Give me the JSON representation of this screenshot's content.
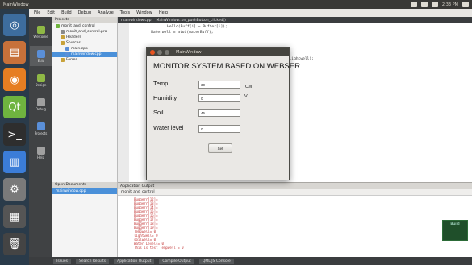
{
  "top_panel": {
    "title": "MainWindow",
    "time": "2:33 PM"
  },
  "launcher": {
    "items": [
      {
        "name": "dash-icon",
        "glyph": "◎",
        "color": "#3d6d9e"
      },
      {
        "name": "files-icon",
        "glyph": "▤",
        "color": "#c7713a"
      },
      {
        "name": "firefox-icon",
        "glyph": "◉",
        "color": "#e67e22"
      },
      {
        "name": "qtcreator-icon",
        "glyph": "Qt",
        "color": "#6fb43f"
      },
      {
        "name": "terminal-icon",
        "glyph": ">_",
        "color": "#2e2e2e"
      },
      {
        "name": "writer-icon",
        "glyph": "▥",
        "color": "#3b7dd8"
      },
      {
        "name": "settings-icon",
        "glyph": "⚙",
        "color": "#7a7a7a"
      },
      {
        "name": "workspace-icon",
        "glyph": "▦",
        "color": "#555"
      },
      {
        "name": "trash-icon",
        "glyph": "🗑",
        "color": "#444"
      }
    ]
  },
  "qtc": {
    "menu": [
      "File",
      "Edit",
      "Build",
      "Debug",
      "Analyze",
      "Tools",
      "Window",
      "Help"
    ],
    "modes": [
      "Welcome",
      "Edit",
      "Design",
      "Debug",
      "Projects",
      "Help"
    ],
    "projects_header": "Projects",
    "tree": [
      {
        "label": "monit_and_control",
        "indent": 4,
        "sel": false
      },
      {
        "label": "monit_and_control.pro",
        "indent": 10,
        "sel": false
      },
      {
        "label": "Headers",
        "indent": 10,
        "sel": false
      },
      {
        "label": "Sources",
        "indent": 10,
        "sel": false
      },
      {
        "label": "main.cpp",
        "indent": 16,
        "sel": false
      },
      {
        "label": "mainwindow.cpp",
        "indent": 16,
        "sel": true
      },
      {
        "label": "Forms",
        "indent": 10,
        "sel": false
      }
    ],
    "open_docs_header": "Open Documents",
    "open_docs_items": [
      "mainwindow.cpp"
    ],
    "editor_tabs": [
      "mainwindow.cpp",
      "MainWindow::on_pushButton_clicked()"
    ],
    "code_lines": [
      "    Hello(Buff[i] = Buffer[i]);",
      "    Waterwell = atoi(waterBuff);",
      "    ui->label->setText(QString(\"%1 %2 %3\").arg(soilwell, Tempwell,lightwell);"
    ],
    "output_header": "Application Output",
    "output_tab": "monit_and_control",
    "output_lines": [
      "Buggerr[12]=",
      "Buggerr[13]=",
      "Buggerr[14]=",
      "Buggerr[15]=",
      "Buggerr[16]=",
      "Buggerr[17]=",
      "Buggerr[18]=",
      "Buggerr[19]=",
      "Tempwell= 0",
      "lightwell= 0",
      "soilwell= 0",
      "Water Levels= 0",
      "This is test Tempwell = 0"
    ],
    "status_tabs": [
      "Issues",
      "Search Results",
      "Application Output",
      "Compile Output",
      "QML/JS Console"
    ],
    "build_badge": "Build"
  },
  "dialog": {
    "title": "MainWindow",
    "heading": "MONITOR SYSTEM BASED ON WEBSER",
    "fields": [
      {
        "key": "temp",
        "label": "Temp",
        "value": "30",
        "unit": "Cel"
      },
      {
        "key": "humidity",
        "label": "Humidity",
        "value": "0",
        "unit": "V"
      },
      {
        "key": "soil",
        "label": "Soil",
        "value": "45",
        "unit": ""
      },
      {
        "key": "water",
        "label": "Water level",
        "value": "0",
        "unit": ""
      }
    ],
    "button_label": "Set"
  },
  "colors": {
    "accent_orange": "#e95420",
    "launcher_bg": "#2a3b4a",
    "qt_green": "#8fb845"
  }
}
